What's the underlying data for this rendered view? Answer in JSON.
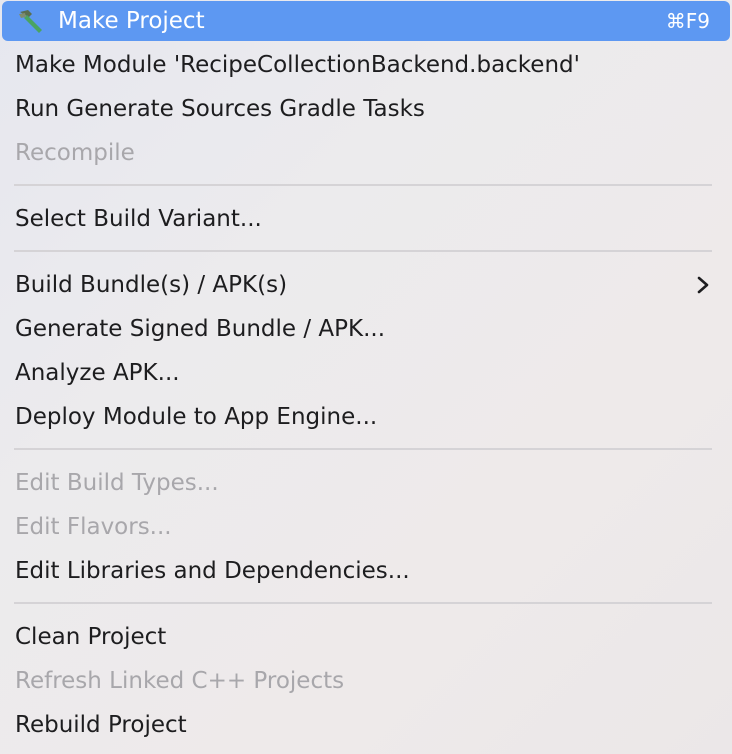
{
  "menu": {
    "items": [
      {
        "label": "Make Project",
        "shortcut": "⌘F9",
        "icon": "hammer-icon",
        "state": "highlighted"
      },
      {
        "label": "Make Module 'RecipeCollectionBackend.backend'",
        "state": "enabled"
      },
      {
        "label": "Run Generate Sources Gradle Tasks",
        "state": "enabled"
      },
      {
        "label": "Recompile",
        "state": "disabled"
      },
      {
        "label": "Select Build Variant...",
        "state": "enabled"
      },
      {
        "label": "Build Bundle(s) / APK(s)",
        "state": "enabled",
        "submenu": true,
        "submenu_icon": "chevron-right-icon"
      },
      {
        "label": "Generate Signed Bundle / APK...",
        "state": "enabled"
      },
      {
        "label": "Analyze APK...",
        "state": "enabled"
      },
      {
        "label": "Deploy Module to App Engine...",
        "state": "enabled"
      },
      {
        "label": "Edit Build Types...",
        "state": "disabled"
      },
      {
        "label": "Edit Flavors...",
        "state": "disabled"
      },
      {
        "label": "Edit Libraries and Dependencies...",
        "state": "enabled"
      },
      {
        "label": "Clean Project",
        "state": "enabled"
      },
      {
        "label": "Refresh Linked C++ Projects",
        "state": "disabled"
      },
      {
        "label": "Rebuild Project",
        "state": "enabled"
      }
    ]
  },
  "colors": {
    "highlight": "#5d98f2",
    "text": "#1d1d1f",
    "disabled_text": "#a8a7ab",
    "separator": "#d5d3d6",
    "hammer_handle": "#3f9d5a"
  }
}
